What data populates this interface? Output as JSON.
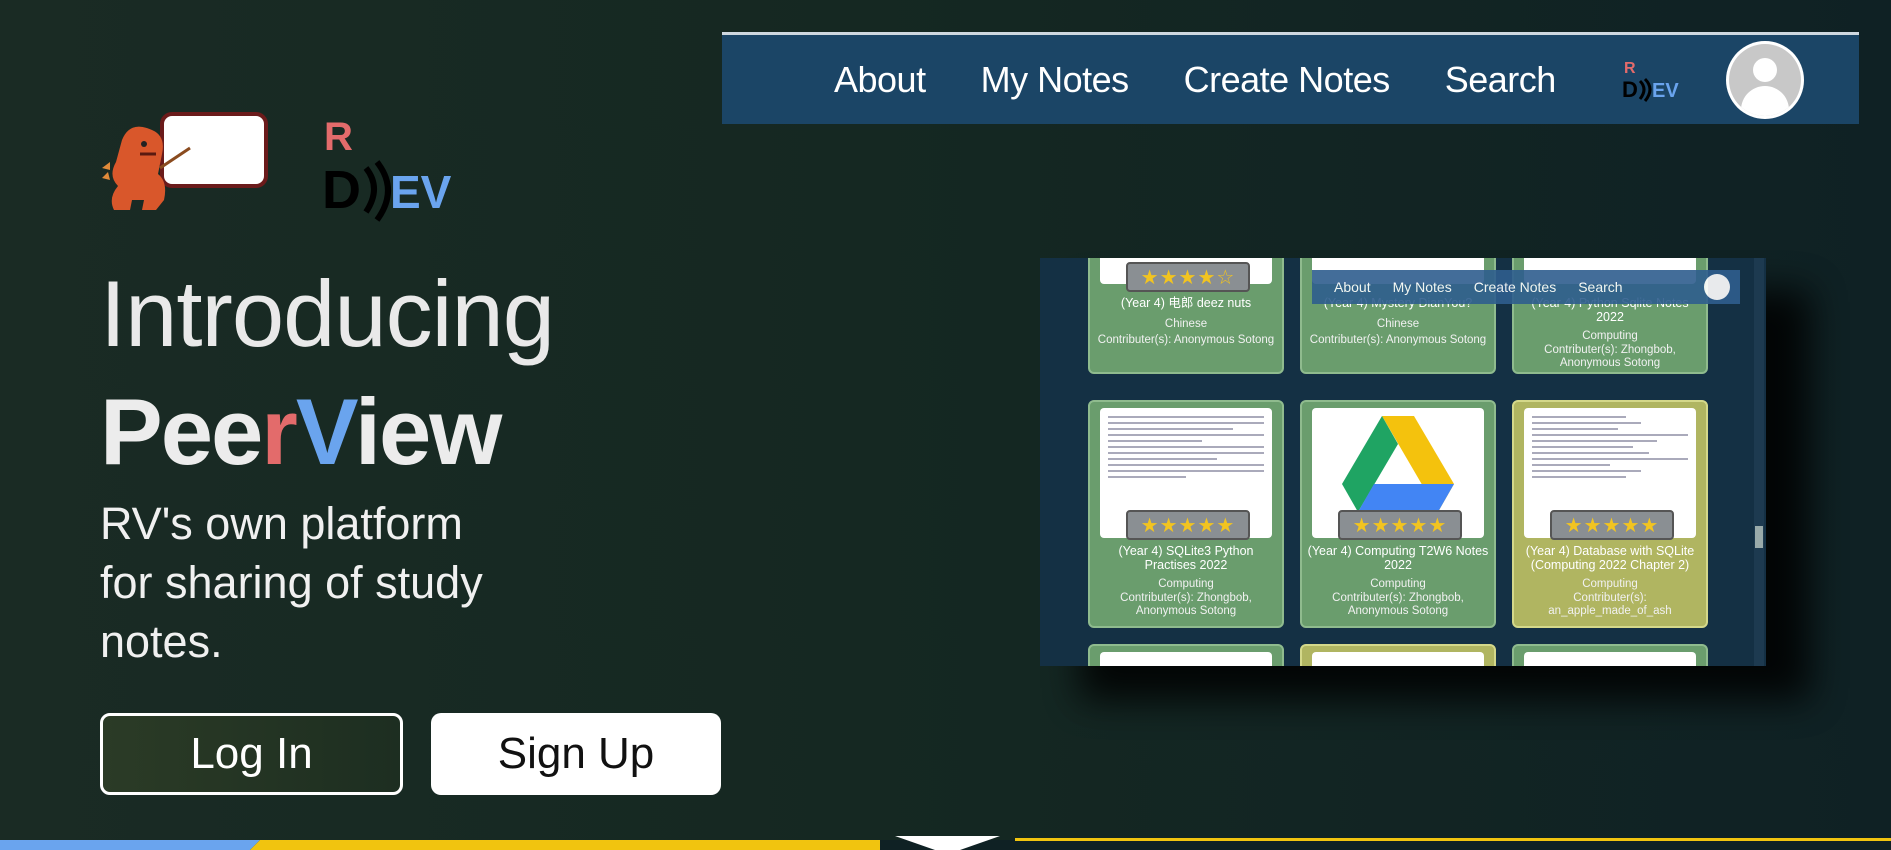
{
  "navbar": {
    "links": [
      "About",
      "My Notes",
      "Create Notes",
      "Search"
    ],
    "logo_letters": {
      "r": "R",
      "d": "D",
      "ev": "EV"
    }
  },
  "hero": {
    "intro": "Introducing",
    "name_parts": [
      "Pee",
      "r",
      "V",
      "iew"
    ],
    "tagline": "RV's own platform for sharing of study notes.",
    "login_label": "Log In",
    "signup_label": "Sign Up"
  },
  "brand": {
    "letters_r": "R",
    "letters_d": "D",
    "letters_ev": "EV"
  },
  "preview": {
    "mini_nav": [
      "About",
      "My Notes",
      "Create Notes",
      "Search"
    ],
    "top_cards": [
      {
        "title": "(Year 4) 电郎 deez nuts",
        "subject": "Chinese",
        "contributors": "Contributer(s): Anonymous Sotong"
      },
      {
        "title": "(Year 4) Mystery DianYou?",
        "subject": "Chinese",
        "contributors": "Contributer(s): Anonymous Sotong"
      },
      {
        "title": "(Year 4) Python Sqlite Notes 2022",
        "subject": "Computing",
        "contributors": "Contributer(s): Zhongbob, Anonymous Sotong"
      }
    ],
    "cards": [
      {
        "title": "(Year 4) SQLite3 Python Practises 2022",
        "subject": "Computing",
        "contributors": "Contributer(s): Zhongbob, Anonymous Sotong",
        "rating": "★★★★★"
      },
      {
        "title": "(Year 4) Computing T2W6 Notes 2022",
        "subject": "Computing",
        "contributors": "Contributer(s): Zhongbob, Anonymous Sotong",
        "rating": "★★★★★"
      },
      {
        "title": "(Year 4) Database with SQLite (Computing 2022 Chapter 2)",
        "subject": "Computing",
        "contributors": "Contributer(s): an_apple_made_of_ash",
        "rating": "★★★★★"
      }
    ],
    "top_rating": "★★★★☆"
  },
  "colors": {
    "navbar": "#1b4566",
    "accent_red": "#e36b6b",
    "accent_blue": "#6aa4ee",
    "card_green": "#6a9d6d",
    "card_yellow": "#b0b561"
  }
}
